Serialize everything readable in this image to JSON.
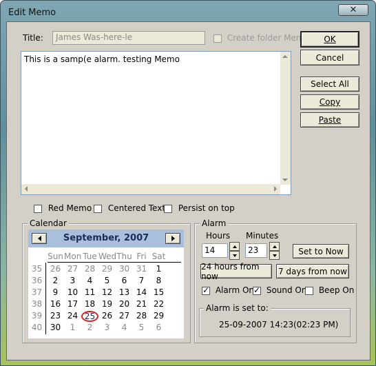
{
  "window": {
    "title": "Edit Memo"
  },
  "form": {
    "title_label": "Title:",
    "title_value": "James Was-here-le",
    "create_folder_label": "Create folder Memo",
    "memo_text": "This is a samp(e alarm. testing Memo"
  },
  "buttons": {
    "ok": "OK",
    "cancel": "Cancel",
    "select_all": "Select All",
    "copy": "Copy",
    "paste": "Paste"
  },
  "options": {
    "red_memo": "Red Memo",
    "centered_text": "Centered Text",
    "persist_on_top": "Persist on top"
  },
  "calendar": {
    "group_label": "Calendar",
    "month_year": "September, 2007",
    "day_names": [
      "Sun",
      "Mon",
      "Tue",
      "Wed",
      "Thu",
      "Fri",
      "Sat"
    ],
    "weeks": [
      {
        "num": "35",
        "days": [
          "26",
          "27",
          "28",
          "29",
          "30",
          "31",
          "1"
        ]
      },
      {
        "num": "36",
        "days": [
          "2",
          "3",
          "4",
          "5",
          "6",
          "7",
          "8"
        ]
      },
      {
        "num": "37",
        "days": [
          "9",
          "10",
          "11",
          "12",
          "13",
          "14",
          "15"
        ]
      },
      {
        "num": "38",
        "days": [
          "16",
          "17",
          "18",
          "19",
          "20",
          "21",
          "22"
        ]
      },
      {
        "num": "39",
        "days": [
          "23",
          "24",
          "25",
          "26",
          "27",
          "28",
          "29"
        ]
      },
      {
        "num": "40",
        "days": [
          "30",
          "1",
          "2",
          "3",
          "4",
          "5",
          "6"
        ]
      }
    ],
    "colors": {
      "header_bg": "#a9c0dc",
      "muted": "#8a8a8a",
      "today_ring": "#d62020"
    }
  },
  "alarm": {
    "group_label": "Alarm",
    "hours_label": "Hours",
    "minutes_label": "Minutes",
    "hours_value": "14",
    "minutes_value": "23",
    "set_to_now": "Set to Now",
    "plus_24h": "24 hours from now",
    "plus_7d": "7 days from now",
    "alarm_on": "Alarm On",
    "sound_on": "Sound On",
    "beep_on": "Beep On",
    "status_label": "Alarm is set to:",
    "status_datetime": "25-09-2007 14:23",
    "status_12h": "(02:23  PM)"
  }
}
